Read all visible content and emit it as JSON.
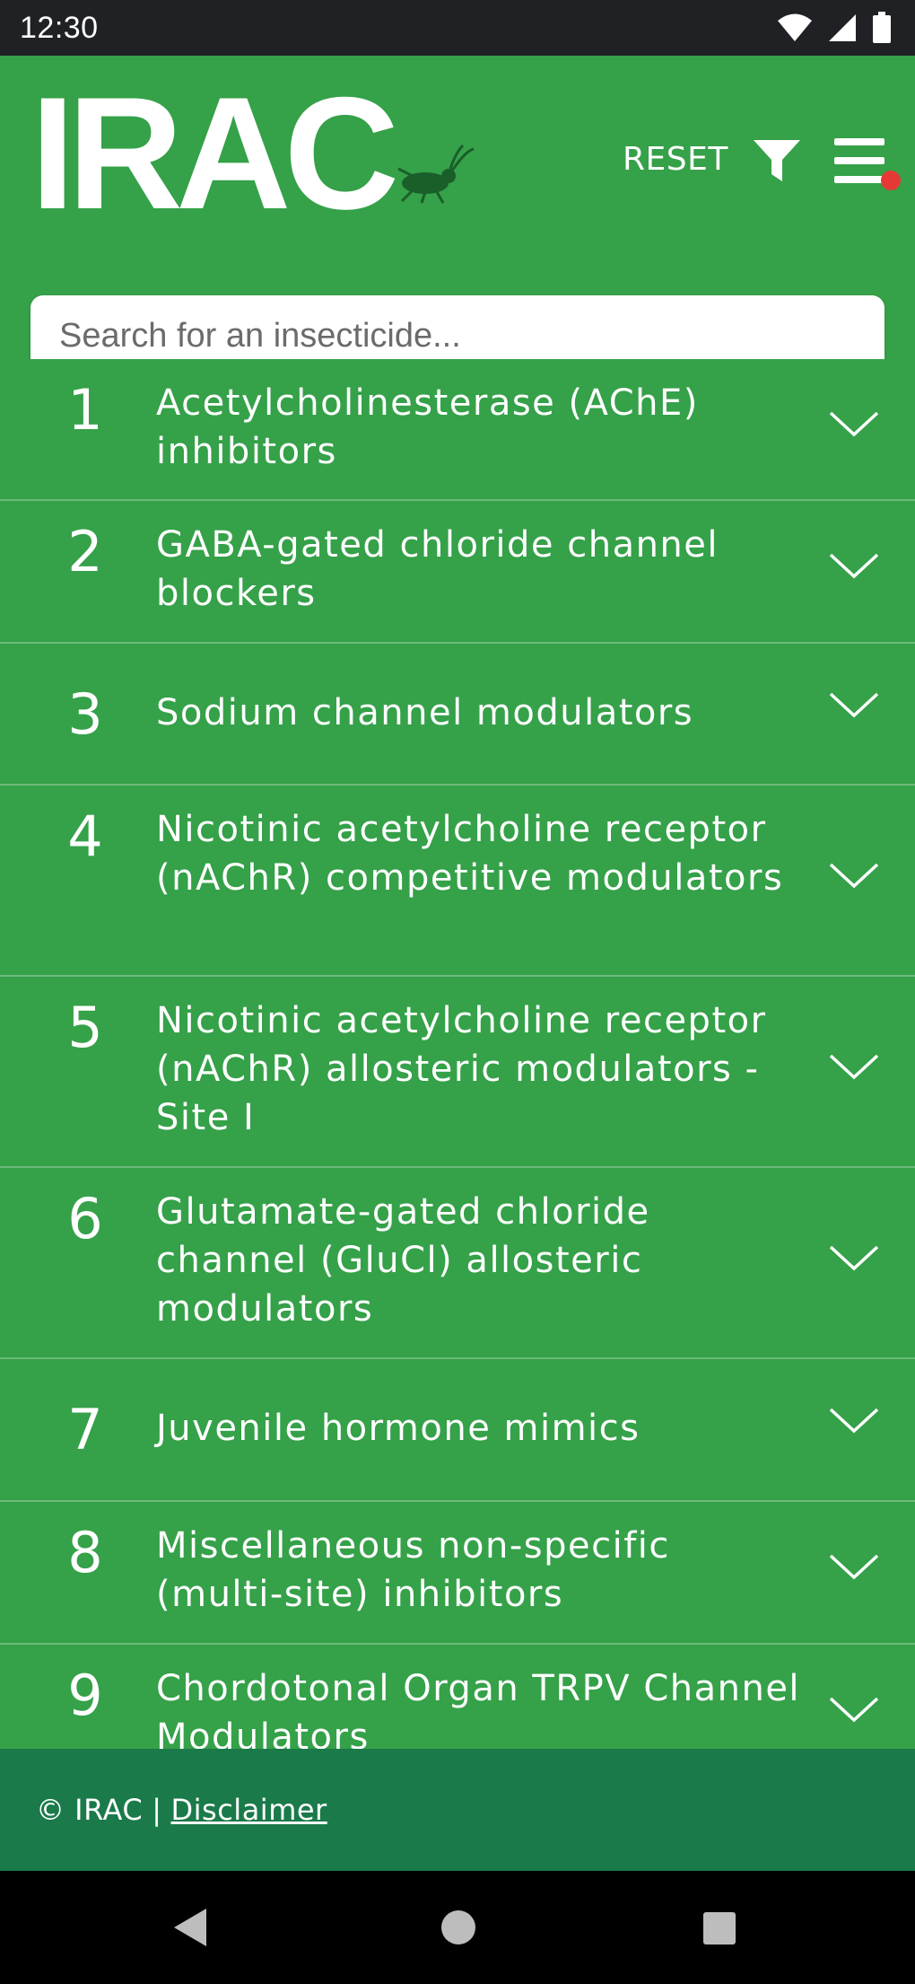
{
  "status_bar": {
    "time": "12:30",
    "icons": [
      "wifi-icon",
      "cell-signal-icon",
      "battery-icon"
    ]
  },
  "header": {
    "logo_text": "IRAC",
    "reset_label": "RESET",
    "search_placeholder": "Search for an insecticide...",
    "notification_color": "#e53935"
  },
  "groups": [
    {
      "number": "1",
      "lines": [
        "Acetylcholinesterase (AChE)",
        "inhibitors"
      ]
    },
    {
      "number": "2",
      "lines": [
        "GABA-gated chloride channel",
        "blockers"
      ]
    },
    {
      "number": "3",
      "lines": [
        "Sodium channel modulators"
      ]
    },
    {
      "number": "4",
      "lines": [
        "Nicotinic acetylcholine receptor",
        "(nAChR) competitive modulators"
      ]
    },
    {
      "number": "5",
      "lines": [
        "Nicotinic acetylcholine receptor",
        "(nAChR) allosteric modulators -",
        "Site I"
      ]
    },
    {
      "number": "6",
      "lines": [
        "Glutamate-gated chloride",
        "channel (GluCl) allosteric",
        "modulators"
      ]
    },
    {
      "number": "7",
      "lines": [
        "Juvenile hormone mimics"
      ]
    },
    {
      "number": "8",
      "lines": [
        "Miscellaneous non-specific",
        "(multi-site) inhibitors"
      ]
    },
    {
      "number": "9",
      "lines": [
        "Chordotonal Organ TRPV Channel",
        "Modulators"
      ]
    }
  ],
  "footer": {
    "copyright": "© IRAC",
    "separator": "|",
    "disclaimer": "Disclaimer"
  },
  "colors": {
    "primary_green": "#35a149",
    "footer_green": "#1a7a4a",
    "status_bar": "#202124",
    "nav_bar": "#000000"
  }
}
